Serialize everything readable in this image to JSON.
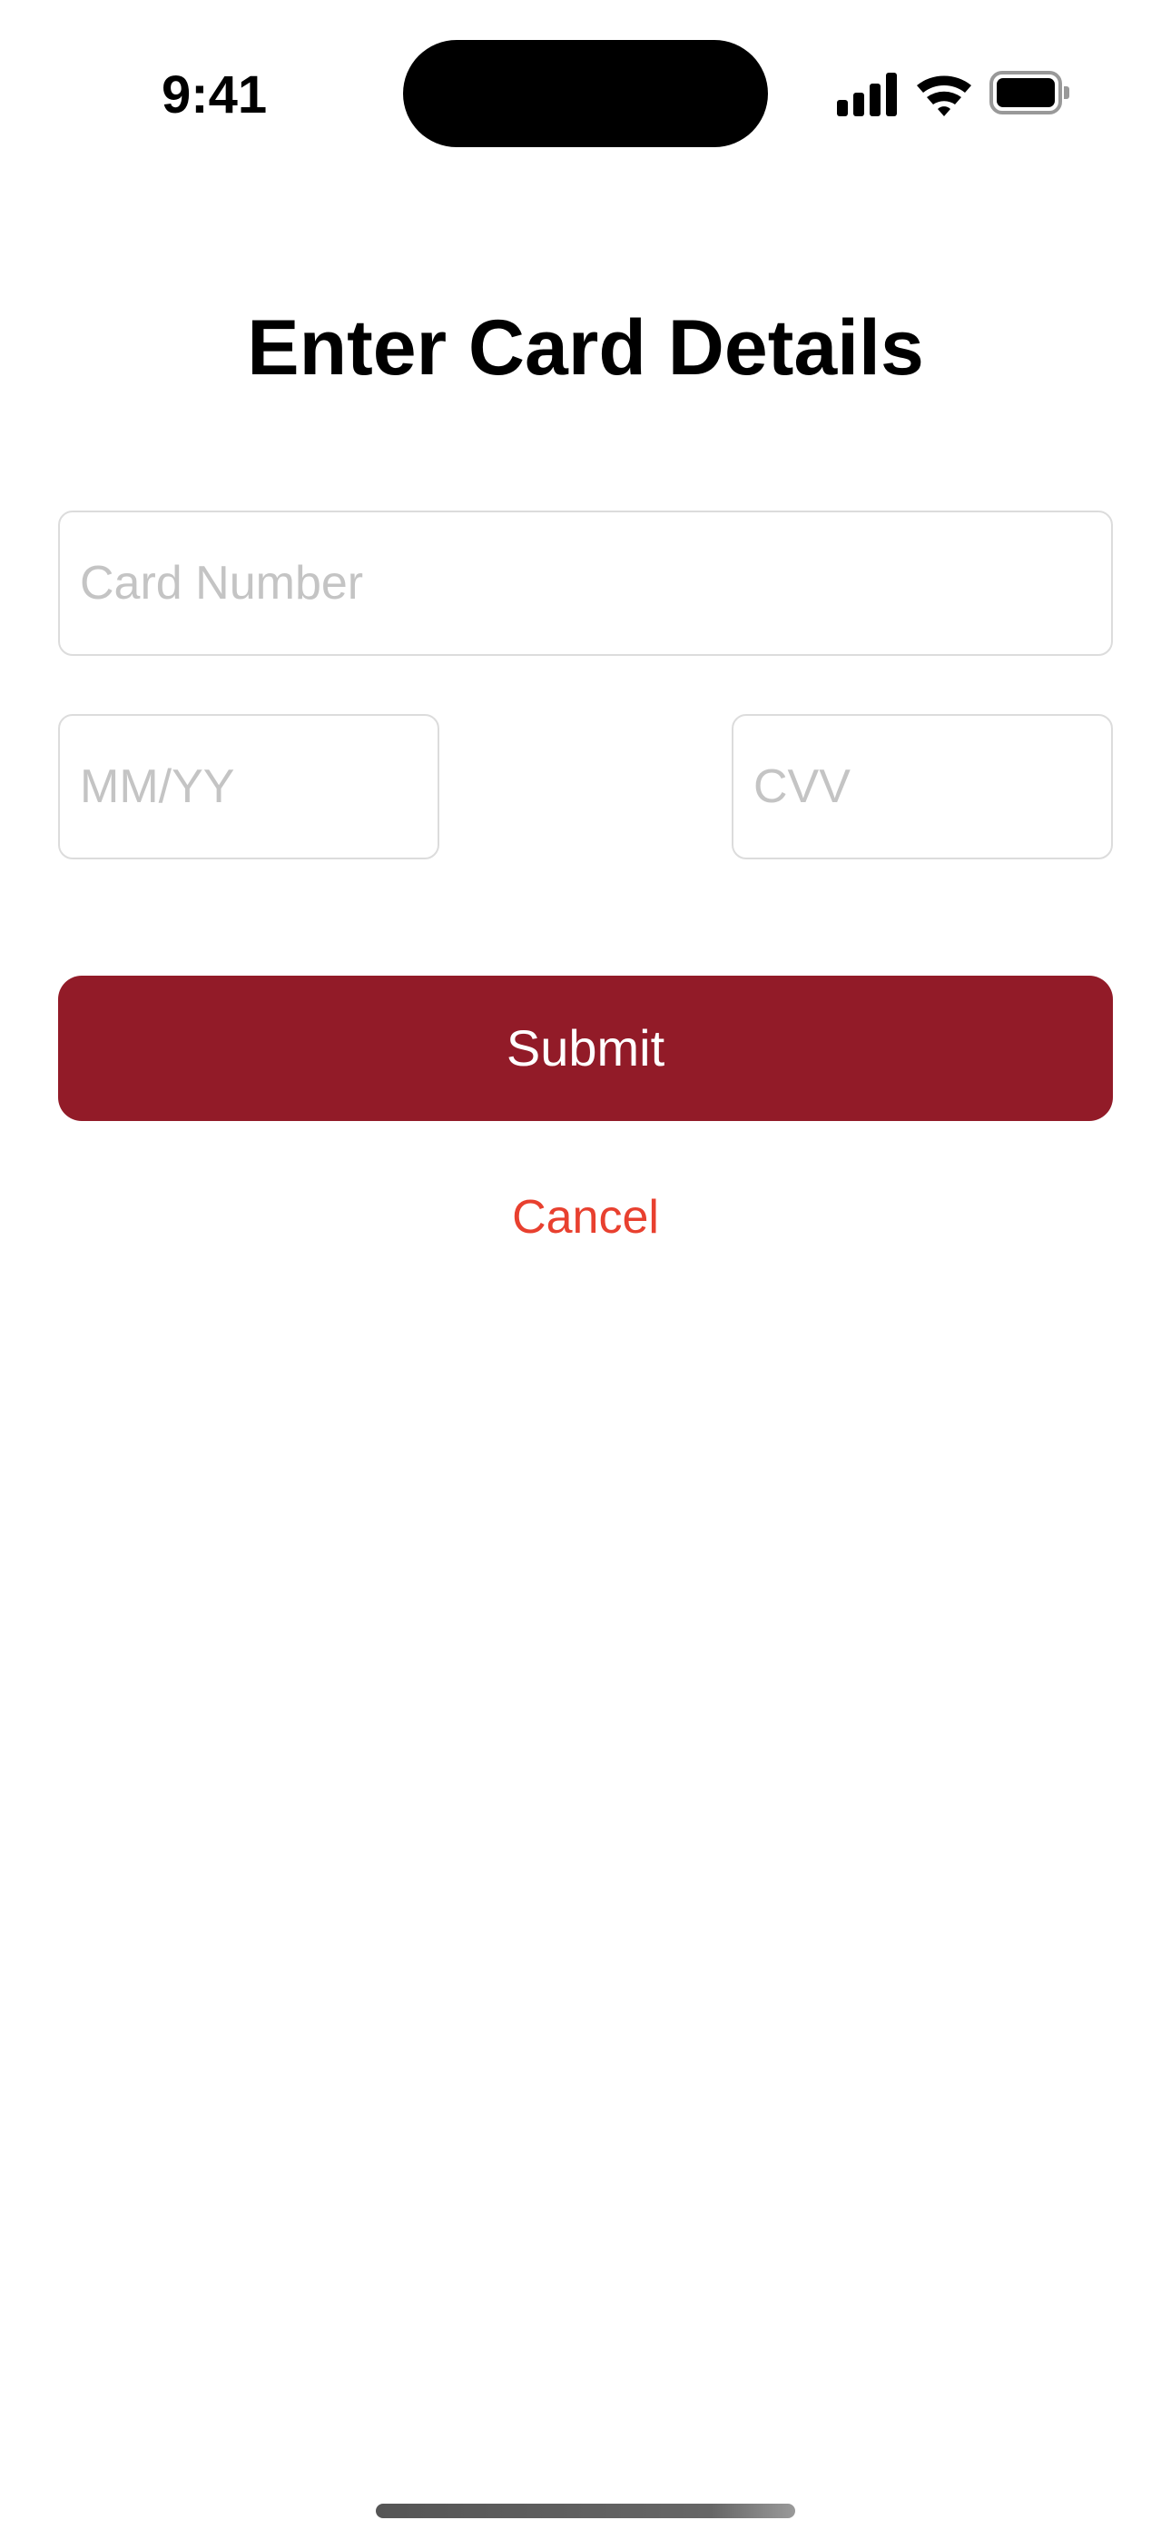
{
  "status_bar": {
    "time": "9:41",
    "icons": [
      "cellular-signal-icon",
      "wifi-icon",
      "battery-icon"
    ]
  },
  "title": "Enter Card Details",
  "form": {
    "card_number": {
      "placeholder": "Card Number",
      "value": ""
    },
    "expiry": {
      "placeholder": "MM/YY",
      "value": ""
    },
    "cvv": {
      "placeholder": "CVV",
      "value": ""
    }
  },
  "actions": {
    "submit_label": "Submit",
    "cancel_label": "Cancel"
  },
  "colors": {
    "submit_background": "#921b28",
    "cancel_text": "#e8402f",
    "placeholder_text": "#c4c4c4",
    "input_border": "#dcdcdc"
  }
}
